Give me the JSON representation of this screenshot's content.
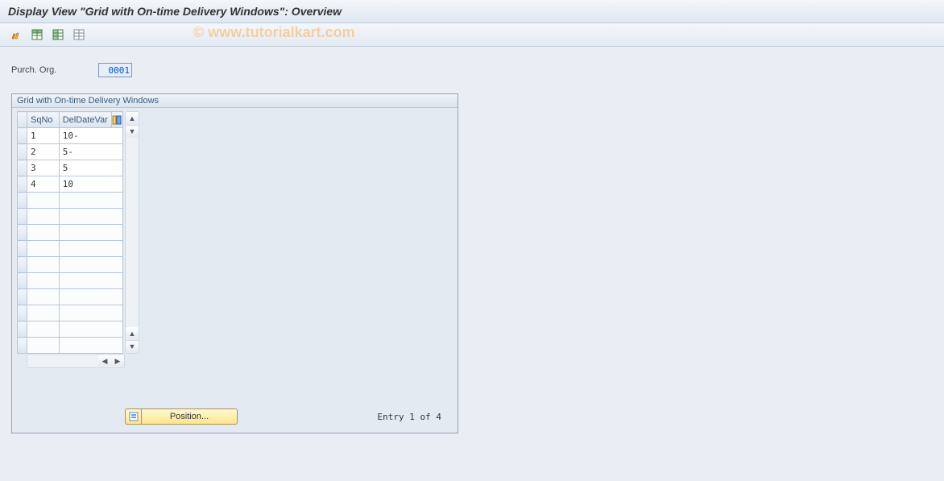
{
  "title": "Display View \"Grid with On-time Delivery Windows\": Overview",
  "watermark": "© www.tutorialkart.com",
  "toolbar_icons": {
    "change": "change-display-icon",
    "select_all": "select-all-icon",
    "select_block": "select-block-icon",
    "deselect_all": "deselect-all-icon"
  },
  "field": {
    "label": "Purch. Org.",
    "value": "0001"
  },
  "panel": {
    "title": "Grid with On-time Delivery Windows",
    "columns": {
      "sel": "",
      "sqno": "SqNo",
      "deldatevar": "DelDateVar"
    },
    "rows": [
      {
        "sqno": "1",
        "del": "10-"
      },
      {
        "sqno": "2",
        "del": "5-"
      },
      {
        "sqno": "3",
        "del": "5"
      },
      {
        "sqno": "4",
        "del": "10"
      },
      {
        "sqno": "",
        "del": ""
      },
      {
        "sqno": "",
        "del": ""
      },
      {
        "sqno": "",
        "del": ""
      },
      {
        "sqno": "",
        "del": ""
      },
      {
        "sqno": "",
        "del": ""
      },
      {
        "sqno": "",
        "del": ""
      },
      {
        "sqno": "",
        "del": ""
      },
      {
        "sqno": "",
        "del": ""
      },
      {
        "sqno": "",
        "del": ""
      },
      {
        "sqno": "",
        "del": ""
      }
    ],
    "position_button": "Position...",
    "entry_text": "Entry 1 of 4"
  }
}
